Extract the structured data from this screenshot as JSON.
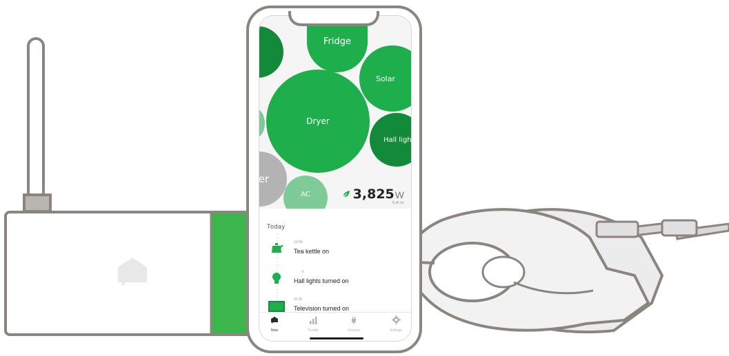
{
  "bubbles": {
    "fridge": "Fridge",
    "solar": "Solar",
    "dryer": "Dryer",
    "hall_lights": "Hall light",
    "partial": "er",
    "ac": "AC"
  },
  "total": {
    "value": "3,825",
    "unit": "W",
    "rate": "$.46 /hr"
  },
  "feed": {
    "heading": "Today",
    "events": [
      {
        "time": "12:58",
        "label": "Tea kettle on"
      },
      {
        "time": "6",
        "label": "Hall lights turned on"
      },
      {
        "time": "11:25",
        "label": "Television turned on"
      }
    ]
  },
  "tabs": [
    {
      "label": "Now",
      "icon": "chat-bubble-icon"
    },
    {
      "label": "Trends",
      "icon": "bar-chart-icon"
    },
    {
      "label": "Devices",
      "icon": "plug-icon"
    },
    {
      "label": "Settings",
      "icon": "gear-icon"
    }
  ],
  "colors": {
    "green": "#1fae4c",
    "dark_green": "#128a3a",
    "light_green": "#7fcb98",
    "gray_bubble": "#b3b3b3",
    "device_outline": "#8b8580",
    "monitor_band": "#3cb54c"
  }
}
